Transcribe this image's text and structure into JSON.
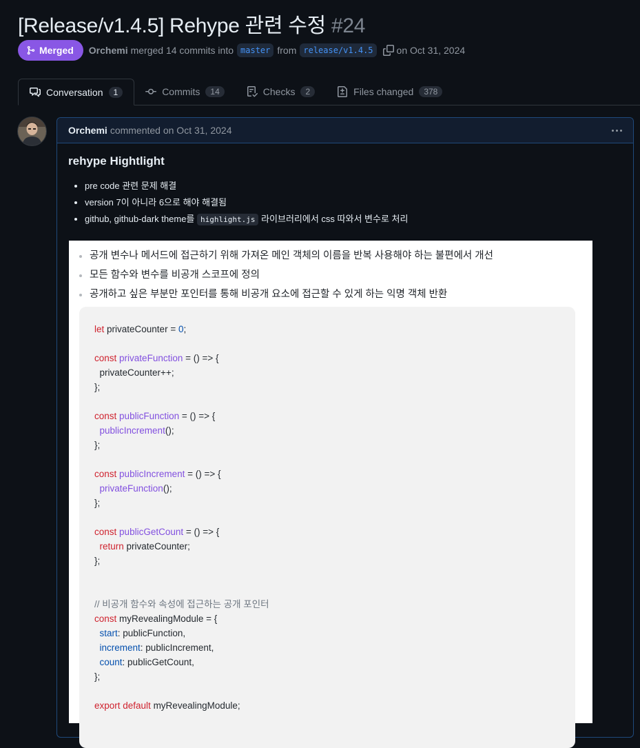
{
  "pr": {
    "title": "[Release/v1.4.5] Rehype 관련 수정",
    "number": "#24",
    "status": "Merged",
    "author": "Orchemi",
    "merge_text": "merged 14 commits into",
    "base_branch": "master",
    "from_text": "from",
    "head_branch": "release/v1.4.5",
    "date_text": "on Oct 31, 2024"
  },
  "tabs": [
    {
      "label": "Conversation",
      "count": "1",
      "icon": "comment-discussion-icon"
    },
    {
      "label": "Commits",
      "count": "14",
      "icon": "git-commit-icon"
    },
    {
      "label": "Checks",
      "count": "2",
      "icon": "checklist-icon"
    },
    {
      "label": "Files changed",
      "count": "378",
      "icon": "file-diff-icon"
    }
  ],
  "comment": {
    "author": "Orchemi",
    "meta": "commented on Oct 31, 2024",
    "heading": "rehype Hightlight",
    "items": [
      {
        "text": "pre code 관련 문제 해결"
      },
      {
        "text": "version 7이 아니라 6으로 해야 해결됨"
      },
      {
        "before": "github, github-dark theme를 ",
        "code": "highlight.js",
        "after": " 라이브러리에서 css 따와서 변수로 처리"
      }
    ]
  },
  "screenshot": {
    "bullets": [
      "공개 변수나 메서드에 접근하기 위해 가져온 메인 객체의 이름을 반복 사용해야 하는 불편에서 개선",
      "모든 함수와 변수를 비공개 스코프에 정의",
      "공개하고 싶은 부분만 포인터를 통해 비공개 요소에 접근할 수 있게 하는 익명 객체 반환"
    ],
    "code": {
      "l1_kw": "let",
      "l1_rest": " privateCounter = ",
      "l1_num": "0",
      "l1_end": ";",
      "c1": "const",
      "f1": "publicFunction",
      "b1": "  privateCounter++;",
      "close": "};",
      "f2": "publicFunction",
      "call2": "publicIncrement",
      "f3": "publicIncrement",
      "call3": "privateFunction",
      "f4": "publicGetCount",
      "ret": "return",
      "ret_rest": " privateCounter;",
      "comment": "// 비공개 함수와 속성에 접근하는 공개 포인터",
      "mod": " myRevealingModule = {",
      "p1": "start",
      "v1": ": publicFunction,",
      "p2": "increment",
      "v2": ": publicIncrement,",
      "p3": "count",
      "v3": ": publicGetCount,",
      "exp": "export default",
      "exp_rest": " myRevealingModule;",
      "arrow": " = () => {",
      "call_end": "();",
      "fn_decl": "privateFunction"
    }
  },
  "colors": {
    "merged": "#8957e5",
    "link": "#4493f8",
    "bg": "#0d1117"
  }
}
